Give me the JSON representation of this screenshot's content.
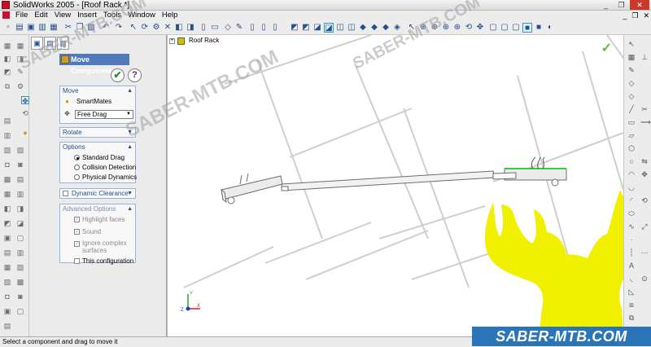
{
  "window": {
    "title": "SolidWorks 2005 - [Roof Rack *]",
    "min": "_",
    "restore": "❐",
    "close": "✕"
  },
  "menu": {
    "items": [
      "File",
      "Edit",
      "View",
      "Insert",
      "Tools",
      "Window",
      "Help"
    ],
    "min": "_",
    "restore": "❐",
    "close": "✕"
  },
  "property_manager": {
    "title": "Move Component",
    "ok": "✔",
    "help": "?",
    "move": {
      "header": "Move",
      "smartmates": "SmartMates",
      "mode": "Free Drag"
    },
    "rotate": {
      "header": "Rotate"
    },
    "options": {
      "header": "Options",
      "items": [
        "Standard Drag",
        "Collision Detection",
        "Physical Dynamics"
      ],
      "selected": 0
    },
    "dynamic_clearance": {
      "header": "Dynamic Clearance"
    },
    "advanced": {
      "header": "Advanced Options",
      "items": [
        {
          "label": "Highlight faces",
          "checked": true,
          "enabled": false
        },
        {
          "label": "Sound",
          "checked": true,
          "enabled": false
        },
        {
          "label": "Ignore complex",
          "checked": true,
          "enabled": false
        },
        {
          "label": "surfaces",
          "checked": false,
          "enabled": false
        },
        {
          "label": "This configuration",
          "checked": false,
          "enabled": true
        }
      ]
    }
  },
  "graphics": {
    "tree_root": "Roof Rack",
    "confirm": "✓",
    "triad": {
      "y": "Y",
      "x": "X",
      "z": "Z"
    }
  },
  "status": {
    "message": "Select a component and drag to move it"
  },
  "watermark": {
    "text": "SABER-MTB.COM",
    "band_text": "SABER-MTB.COM"
  },
  "colors": {
    "model_outline": "#6d6d6d",
    "highlight_edge": "#3cc83c",
    "logo_fill": "#f0f000",
    "band": "#2a74b8"
  }
}
